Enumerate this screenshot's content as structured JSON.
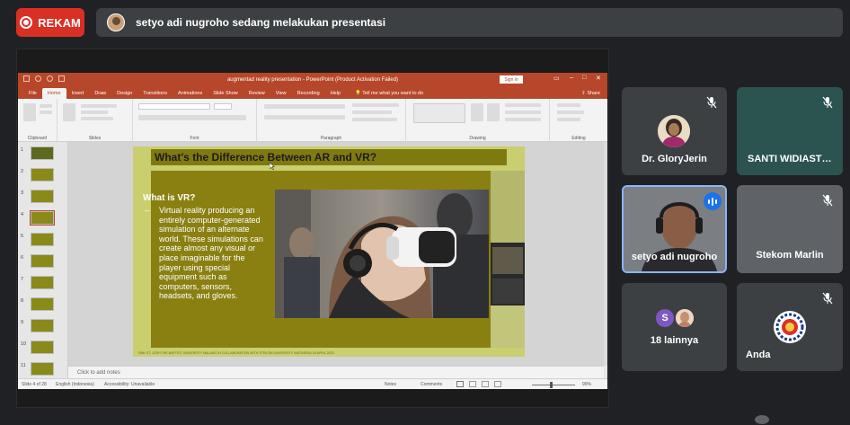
{
  "meet": {
    "record_label": "REKAM",
    "presenting_text": "setyo adi nugroho sedang melakukan presentasi"
  },
  "ppt": {
    "window_title": "augmentad reality presentation  -  PowerPoint (Product Activation Failed)",
    "sign_in": "Sign in",
    "tabs": [
      "File",
      "Home",
      "Insert",
      "Draw",
      "Design",
      "Transitions",
      "Animations",
      "Slide Show",
      "Review",
      "View",
      "Recording",
      "Help"
    ],
    "active_tab": "Home",
    "tell_me": "Tell me what you want to do",
    "share": "Share",
    "ribbon_groups": [
      "Clipboard",
      "Slides",
      "Font",
      "Paragraph",
      "Drawing",
      "Editing"
    ],
    "thumb_numbers": [
      "1",
      "2",
      "3",
      "4",
      "5",
      "6",
      "7",
      "8",
      "9",
      "10",
      "11"
    ],
    "notes_placeholder": "Click to add notes",
    "status": {
      "slide": "Slide 4 of 28",
      "language": "English (Indonesia)",
      "accessibility": "Accessibility: Unavailable",
      "notes": "Notes",
      "comments": "Comments",
      "zoom": "90%"
    }
  },
  "slide": {
    "title": "What's the Difference Between AR and VR?",
    "heading": "What is VR?",
    "bullet_dash": "–",
    "bullet": "Virtual reality producing an entirely computer-generated simulation of an alternate world. These simulations can create almost any visual or place imaginable for the player using special equipment such as computers, sensors, headsets, and gloves.",
    "footer": "SMK ST. JOSH THE BAPTIST UNIVERSITY MALANG IN COLLABORATION WITH STEKOM UNIVERSITY INDONESIA 16 APRIL 2023"
  },
  "participants": [
    {
      "name": "Dr. GloryJerin",
      "muted": true
    },
    {
      "name": "SANTI WIDIASTUTI",
      "muted": true
    },
    {
      "name": "setyo adi nugroho",
      "muted": false,
      "speaking": true
    },
    {
      "name": "Stekom Marlin",
      "muted": true
    },
    {
      "name": "18 lainnya",
      "initial": "S"
    },
    {
      "name": "Anda",
      "muted": true
    }
  ],
  "colors": {
    "record_red": "#d93025",
    "ppt_accent": "#b7472a",
    "slide_olive": "#8a8012",
    "speaking_blue": "#1a73e8",
    "tile_bg": "#3c4043"
  }
}
